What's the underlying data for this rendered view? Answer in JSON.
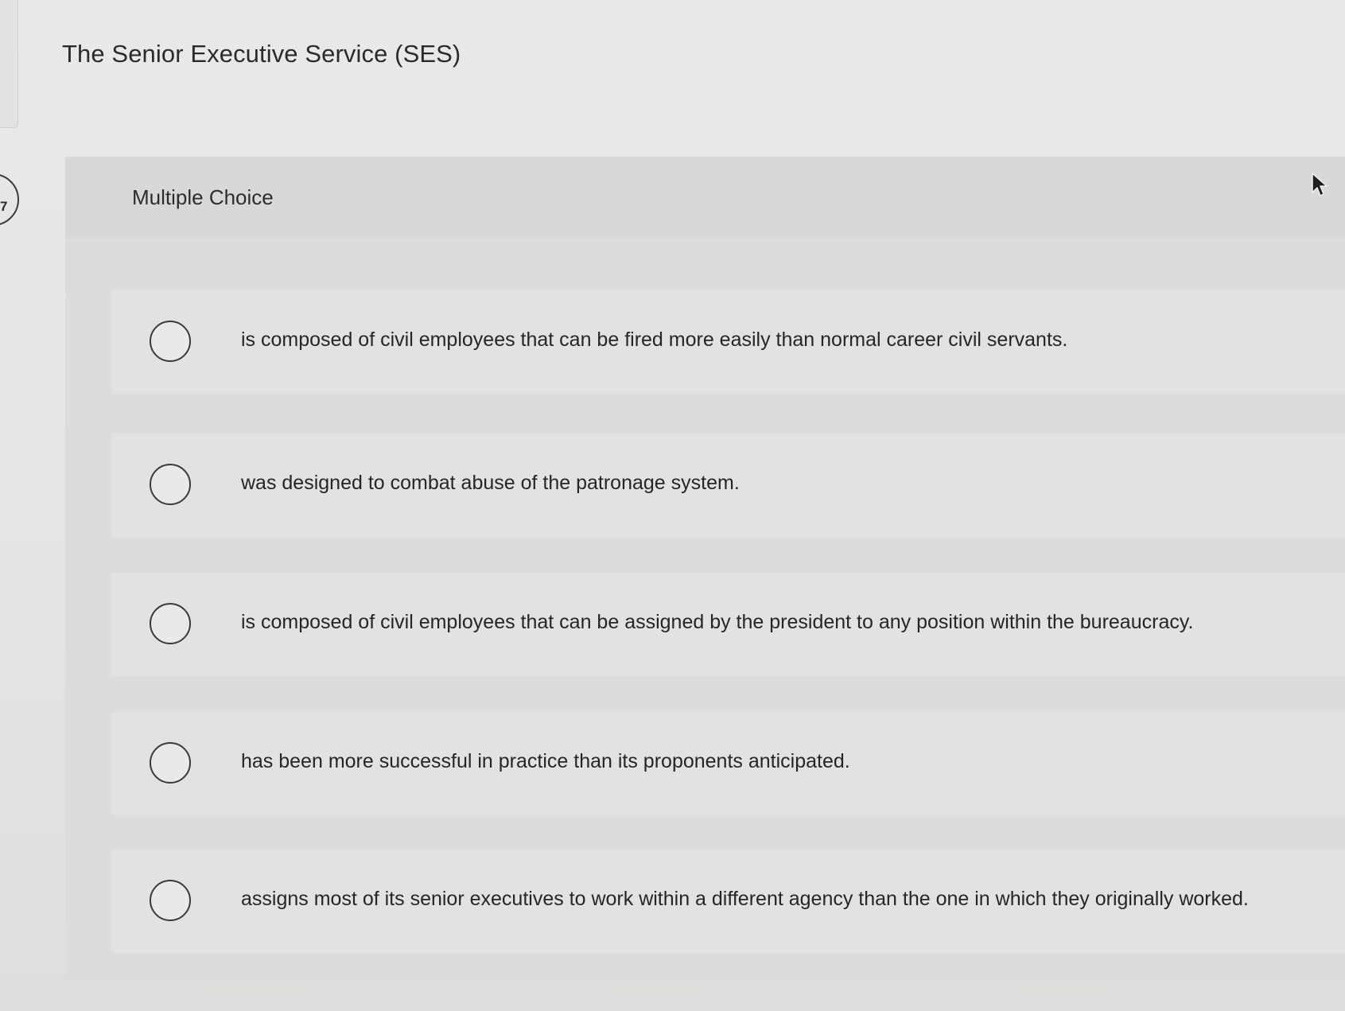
{
  "question": {
    "number": "7",
    "title": "The Senior Executive Service (SES)",
    "type_label": "Multiple Choice",
    "choices": [
      {
        "label": "is composed of civil employees that can be fired more easily than normal career civil servants."
      },
      {
        "label": "was designed to combat abuse of the patronage system."
      },
      {
        "label": "is composed of civil employees that can be assigned by the president to any position within the bureaucracy."
      },
      {
        "label": "has been more successful in practice than its proponents anticipated."
      },
      {
        "label": "assigns most of its senior executives to work within a different agency than the one in which they originally worked."
      }
    ]
  },
  "icons": {
    "cursor": "mouse-pointer-icon",
    "radio": "radio-unchecked-icon"
  },
  "colors": {
    "background": "#e7e7e6",
    "card": "#dcdcdb",
    "text": "#2a2a2a"
  }
}
